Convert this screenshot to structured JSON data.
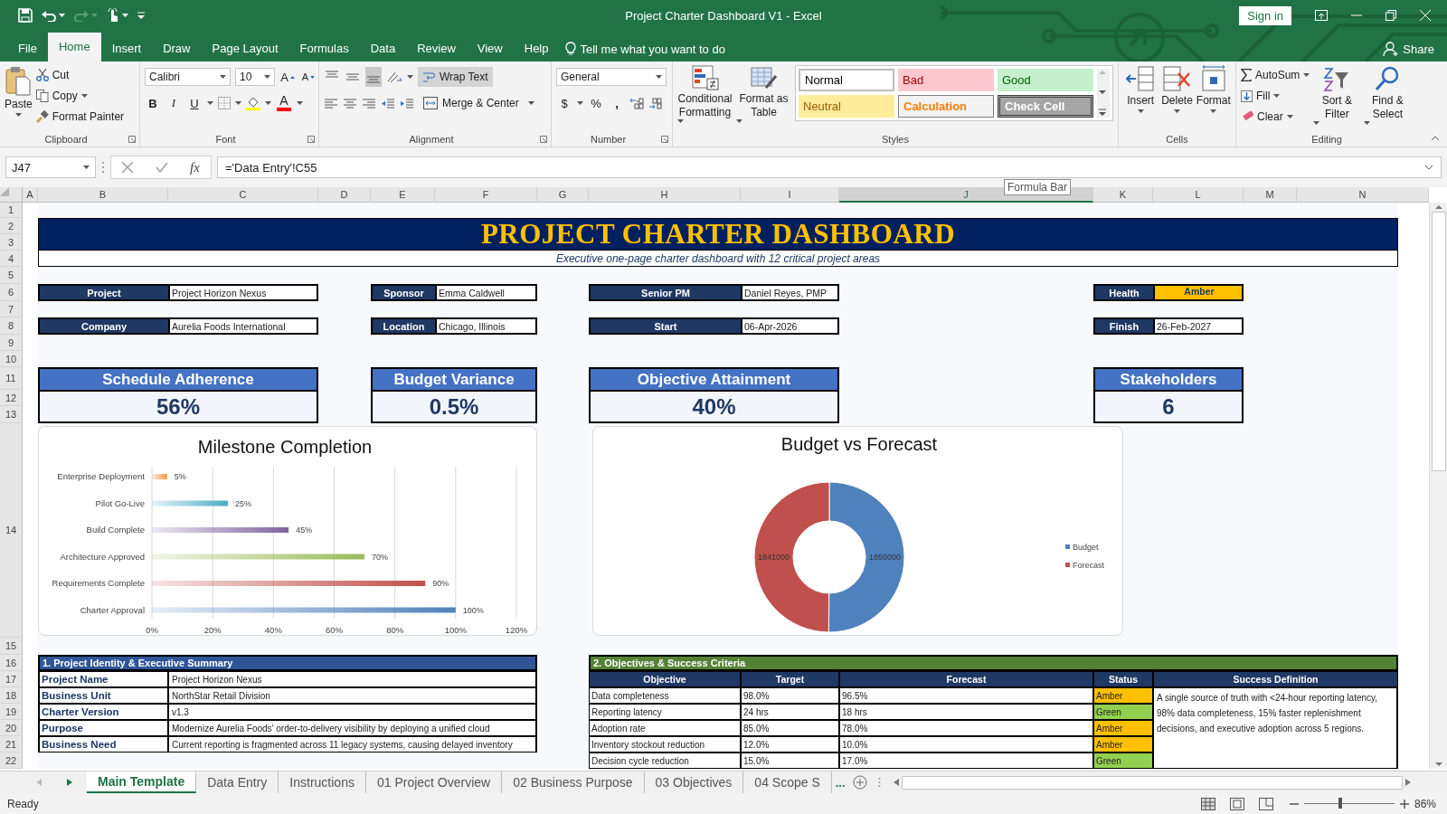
{
  "window": {
    "title": "Project Charter Dashboard V1  -  Excel",
    "sign_in": "Sign in",
    "share": "Share"
  },
  "menu_tabs": [
    {
      "label": "File",
      "selected": false
    },
    {
      "label": "Home",
      "selected": true
    },
    {
      "label": "Insert",
      "selected": false
    },
    {
      "label": "Draw",
      "selected": false
    },
    {
      "label": "Page Layout",
      "selected": false
    },
    {
      "label": "Formulas",
      "selected": false
    },
    {
      "label": "Data",
      "selected": false
    },
    {
      "label": "Review",
      "selected": false
    },
    {
      "label": "View",
      "selected": false
    },
    {
      "label": "Help",
      "selected": false
    }
  ],
  "tell_me": "Tell me what you want to do",
  "ribbon": {
    "clipboard": {
      "label": "Clipboard",
      "paste": "Paste",
      "cut": "Cut",
      "copy": "Copy",
      "format_painter": "Format Painter"
    },
    "font": {
      "label": "Font",
      "family": "Calibri",
      "size": "10",
      "grow": "A",
      "shrink": "A",
      "bold": "B",
      "italic": "I",
      "underline": "U",
      "color_letter": "A"
    },
    "alignment": {
      "label": "Alignment",
      "vertical": [
        {
          "selected": false
        },
        {
          "selected": false
        },
        {
          "selected": true
        }
      ],
      "wrap_text": {
        "label": "Wrap Text",
        "on": true
      },
      "merge": "Merge & Center"
    },
    "number": {
      "label": "Number",
      "format": "General",
      "currency": "$",
      "percent": "%",
      "comma": ","
    },
    "styles": {
      "label": "Styles",
      "conditional": "Conditional Formatting",
      "format_table": "Format as Table",
      "gallery": [
        {
          "label": "Normal",
          "kind": "normal"
        },
        {
          "label": "Bad",
          "kind": "bad"
        },
        {
          "label": "Good",
          "kind": "good"
        },
        {
          "label": "Neutral",
          "kind": "neutral"
        },
        {
          "label": "Calculation",
          "kind": "calculation"
        },
        {
          "label": "Check Cell",
          "kind": "check"
        }
      ]
    },
    "cells": {
      "label": "Cells",
      "buttons": [
        {
          "label": "Insert",
          "kind": "insert"
        },
        {
          "label": "Delete",
          "kind": "delete"
        },
        {
          "label": "Format",
          "kind": "format"
        }
      ]
    },
    "editing": {
      "label": "Editing",
      "autosum": "AutoSum",
      "fill": "Fill",
      "clear": "Clear",
      "sort": "Sort & Filter",
      "find": "Find & Select"
    }
  },
  "formula_bar": {
    "name_box": "J47",
    "fx": "fx",
    "formula": "='Data Entry'!C55",
    "tooltip": "Formula Bar"
  },
  "columns": [
    {
      "label": "A",
      "selected": false
    },
    {
      "label": "B",
      "selected": false
    },
    {
      "label": "C",
      "selected": false
    },
    {
      "label": "D",
      "selected": false
    },
    {
      "label": "E",
      "selected": false
    },
    {
      "label": "F",
      "selected": false
    },
    {
      "label": "G",
      "selected": false
    },
    {
      "label": "H",
      "selected": false
    },
    {
      "label": "I",
      "selected": false
    },
    {
      "label": "J",
      "selected": true
    },
    {
      "label": "K",
      "selected": false
    },
    {
      "label": "L",
      "selected": false
    },
    {
      "label": "M",
      "selected": false
    },
    {
      "label": "N",
      "selected": false
    }
  ],
  "rows": [
    "1",
    "2",
    "3",
    "4",
    "5",
    "6",
    "7",
    "8",
    "9",
    "10",
    "11",
    "12",
    "13",
    "14",
    "15",
    "16",
    "17",
    "18",
    "19",
    "20",
    "21",
    "22"
  ],
  "dashboard": {
    "title": "PROJECT CHARTER DASHBOARD",
    "subtitle": "Executive one-page charter dashboard with 12 critical project areas",
    "fields": [
      {
        "label": "Project",
        "value": "Project Horizon Nexus"
      },
      {
        "label": "Sponsor",
        "value": "Emma Caldwell"
      },
      {
        "label": "Senior PM",
        "value": "Daniel Reyes, PMP"
      },
      {
        "label": "Health",
        "value": "Amber",
        "color": "#ffc000"
      },
      {
        "label": "Company",
        "value": "Aurelia Foods International"
      },
      {
        "label": "Location",
        "value": "Chicago, Illinois"
      },
      {
        "label": "Start",
        "value": "06-Apr-2026"
      },
      {
        "label": "Finish",
        "value": "26-Feb-2027"
      }
    ],
    "kpis": [
      {
        "label": "Schedule Adherence",
        "value": "56%"
      },
      {
        "label": "Budget Variance",
        "value": "0.5%"
      },
      {
        "label": "Objective Attainment",
        "value": "40%"
      },
      {
        "label": "Stakeholders",
        "value": "6"
      }
    ],
    "milestone_chart": {
      "chart_data": {
        "type": "bar",
        "orientation": "horizontal",
        "title": "Milestone Completion",
        "categories": [
          "Enterprise Deployment",
          "Pilot Go-Live",
          "Build Complete",
          "Architecture Approved",
          "Requirements Complete",
          "Charter Approval"
        ],
        "values": [
          5,
          25,
          45,
          70,
          90,
          100
        ],
        "value_labels": [
          "5%",
          "25%",
          "45%",
          "70%",
          "90%",
          "100%"
        ],
        "xlim": [
          0,
          120
        ],
        "xticks": [
          {
            "value": 0,
            "label": "0%"
          },
          {
            "value": 20,
            "label": "20%"
          },
          {
            "value": 40,
            "label": "40%"
          },
          {
            "value": 60,
            "label": "60%"
          },
          {
            "value": 80,
            "label": "80%"
          },
          {
            "value": 100,
            "label": "100%"
          },
          {
            "value": 120,
            "label": "120%"
          }
        ],
        "grid": true
      }
    },
    "budget_chart": {
      "chart_data": {
        "type": "donut",
        "title": "Budget vs Forecast",
        "categories": [
          "Budget",
          "Forecast"
        ],
        "values": [
          1850000,
          1841000
        ],
        "data_labels": true,
        "legend": "right"
      }
    },
    "identity": {
      "title": "1. Project Identity & Executive Summary",
      "rows": [
        {
          "label": "Project Name",
          "value": "Project Horizon Nexus"
        },
        {
          "label": "Business Unit",
          "value": "NorthStar Retail Division"
        },
        {
          "label": "Charter Version",
          "value": "v1.3"
        },
        {
          "label": "Purpose",
          "value": "Modernize Aurelia Foods’ order-to-delivery visibility by deploying a unified cloud"
        },
        {
          "label": "Business Need",
          "value": "Current reporting is fragmented across 11 legacy systems, causing delayed inventory"
        }
      ]
    },
    "objectives": {
      "title": "2. Objectives & Success Criteria",
      "columns": [
        "Objective",
        "Target",
        "Forecast",
        "Status",
        "Success Definition"
      ],
      "rows": [
        {
          "objective": "Data completeness",
          "target": "98.0%",
          "forecast": "96.5%",
          "status": "Amber",
          "color": "#ffc000"
        },
        {
          "objective": "Reporting latency",
          "target": "24 hrs",
          "forecast": "18 hrs",
          "status": "Green",
          "color": "#92d050"
        },
        {
          "objective": "Adoption rate",
          "target": "85.0%",
          "forecast": "78.0%",
          "status": "Amber",
          "color": "#ffc000"
        },
        {
          "objective": "Inventory stockout reduction",
          "target": "12.0%",
          "forecast": "10.0%",
          "status": "Amber",
          "color": "#ffc000"
        },
        {
          "objective": "Decision cycle reduction",
          "target": "15.0%",
          "forecast": "17.0%",
          "status": "Green",
          "color": "#92d050"
        }
      ],
      "success_definition": "A single source of truth with <24-hour reporting latency, 98% data completeness, 15% faster replenishment decisions, and executive adoption across 5 regions."
    }
  },
  "sheet_tabs": [
    {
      "label": "Main Template",
      "selected": true
    },
    {
      "label": "Data Entry",
      "selected": false
    },
    {
      "label": "Instructions",
      "selected": false
    },
    {
      "label": "01 Project Overview",
      "selected": false
    },
    {
      "label": "02 Business Purpose",
      "selected": false
    },
    {
      "label": "03 Objectives",
      "selected": false
    },
    {
      "label": "04 Scope S",
      "selected": false
    }
  ],
  "more_tabs": "...",
  "status": {
    "text": "Ready",
    "zoom": "86%"
  },
  "zoom_slider": {
    "level": 0.4
  }
}
